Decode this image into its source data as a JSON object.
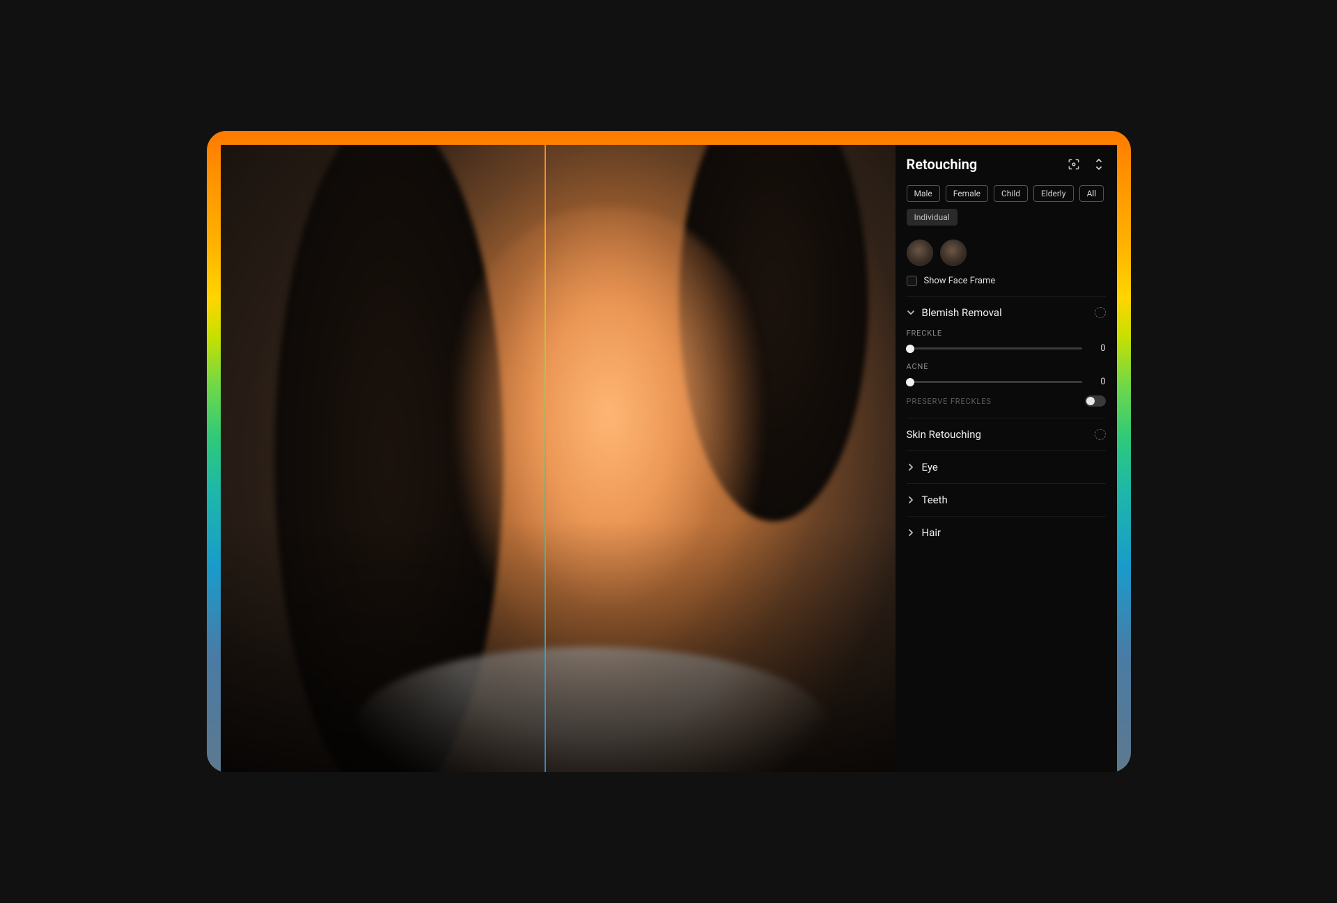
{
  "panel": {
    "title": "Retouching"
  },
  "filters": {
    "chips": [
      "Male",
      "Female",
      "Child",
      "Elderly",
      "All"
    ],
    "mode": "Individual"
  },
  "faceFrame": {
    "label": "Show Face Frame",
    "checked": false
  },
  "blemish": {
    "title": "Blemish Removal",
    "expanded": true,
    "sliders": [
      {
        "label": "FRECKLE",
        "value": 0,
        "min": 0,
        "max": 100
      },
      {
        "label": "ACNE",
        "value": 0,
        "min": 0,
        "max": 100
      }
    ],
    "preserve": {
      "label": "PRESERVE FRECKLES",
      "enabled": false
    }
  },
  "skin": {
    "title": "Skin Retouching"
  },
  "collapsedSections": [
    {
      "title": "Eye"
    },
    {
      "title": "Teeth"
    },
    {
      "title": "Hair"
    }
  ]
}
